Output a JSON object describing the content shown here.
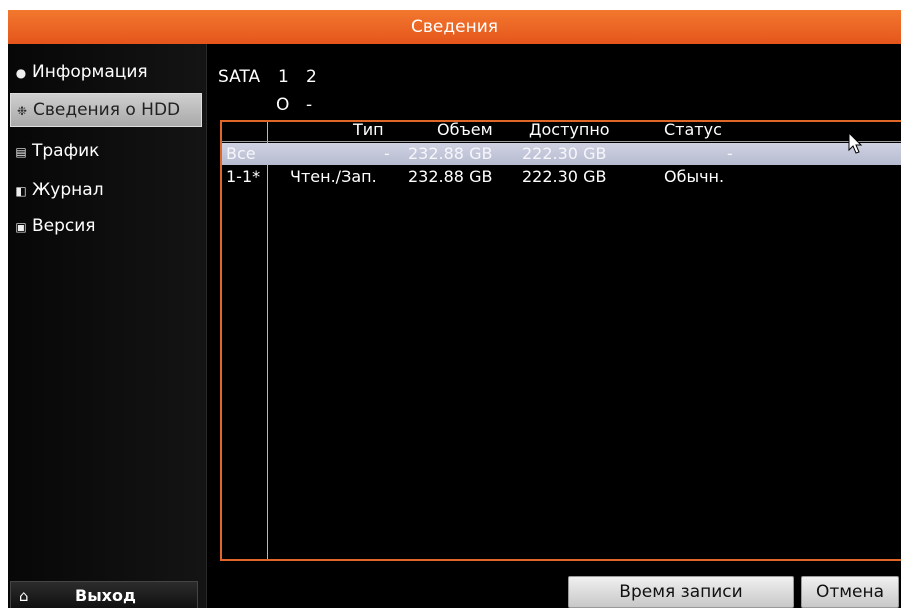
{
  "window": {
    "title": "Сведения"
  },
  "sidebar": {
    "items": [
      {
        "label": "Информация",
        "icon": "info-icon"
      },
      {
        "label": "Сведения о HDD",
        "icon": "gear-icon",
        "active": true
      },
      {
        "label": "Трафик",
        "icon": "traffic-icon"
      },
      {
        "label": "Журнал",
        "icon": "log-icon"
      },
      {
        "label": "Версия",
        "icon": "version-icon"
      }
    ],
    "exit": {
      "label": "Выход",
      "icon": "home-icon"
    }
  },
  "sata": {
    "label": "SATA",
    "ports": [
      "1",
      "2"
    ],
    "states": [
      "O",
      "-"
    ]
  },
  "table": {
    "headers": {
      "type": "Тип",
      "size": "Объем",
      "free": "Доступно",
      "status": "Статус"
    },
    "rows": [
      {
        "id": "Все",
        "type": "-",
        "size": "232.88 GB",
        "free": "222.30 GB",
        "status": "-"
      },
      {
        "id": "1-1*",
        "type": "Чтен./Зап.",
        "size": "232.88 GB",
        "free": "222.30 GB",
        "status": "Обычн."
      }
    ]
  },
  "buttons": {
    "record_time": "Время записи",
    "cancel": "Отмена"
  },
  "colors": {
    "title_bar": "#e8621f",
    "table_border": "#e0662a",
    "selected_row": "#c4c7da"
  }
}
